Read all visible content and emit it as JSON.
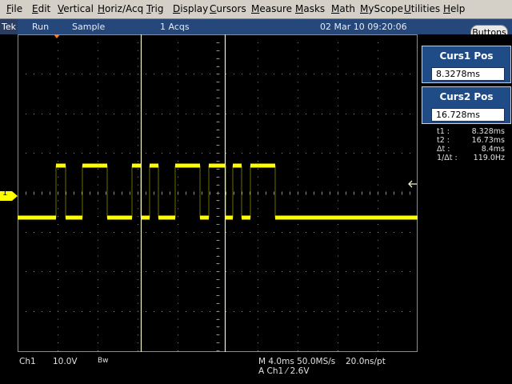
{
  "menu": [
    "File",
    "Edit",
    "Vertical",
    "Horiz/Acq",
    "Trig",
    "Display",
    "Cursors",
    "Measure",
    "Masks",
    "Math",
    "MyScope",
    "Utilities",
    "Help"
  ],
  "status": {
    "brand": "Tek",
    "run_state": "Run",
    "mode": "Sample",
    "acqs": "1 Acqs",
    "datetime": "02 Mar 10 09:20:06"
  },
  "buttons_label": "Buttons",
  "cursors": {
    "curs1_title": "Curs1 Pos",
    "curs1_value": "8.3278ms",
    "curs2_title": "Curs2 Pos",
    "curs2_value": "16.728ms"
  },
  "readouts": [
    {
      "label": "t1 :",
      "value": "8.328ms"
    },
    {
      "label": "t2 :",
      "value": "16.73ms"
    },
    {
      "label": "Δt :",
      "value": "8.4ms"
    },
    {
      "label": "1/Δt :",
      "value": "119.0Hz"
    }
  ],
  "channel_marker": "1",
  "bottom": {
    "ch": "Ch1",
    "volts": "10.0V",
    "bw": "Bw",
    "timebase": "M 4.0ms 50.0MS/s",
    "per_pt": "20.0ns/pt",
    "trigger": "A  Ch1  ⁄  2.6V"
  },
  "colors": {
    "trace": "#ffff00",
    "grid": "#8c8c8c",
    "cursor": "#f0f0c8",
    "panel": "#1f4b87",
    "statusbar": "#25477a"
  },
  "waveform": {
    "levels": [
      "low",
      "high"
    ],
    "pulses": [
      {
        "start": 0.096,
        "end": 0.12
      },
      {
        "start": 0.162,
        "end": 0.224
      },
      {
        "start": 0.286,
        "end": 0.308
      },
      {
        "start": 0.33,
        "end": 0.352
      },
      {
        "start": 0.394,
        "end": 0.456
      },
      {
        "start": 0.478,
        "end": 0.52
      },
      {
        "start": 0.538,
        "end": 0.56
      },
      {
        "start": 0.582,
        "end": 0.644
      }
    ],
    "cursor1_fraction": 0.308,
    "cursor2_fraction": 0.518
  }
}
